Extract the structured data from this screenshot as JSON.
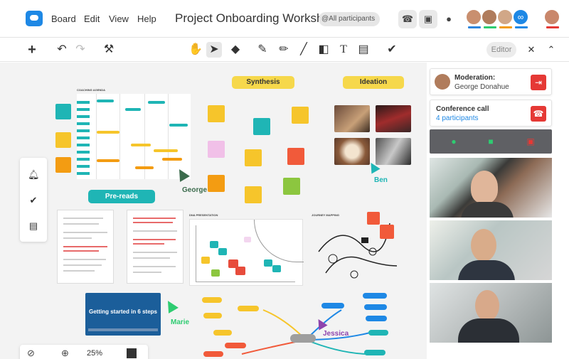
{
  "topbar": {
    "menu": [
      "Board",
      "Edit",
      "View",
      "Help"
    ],
    "title": "Project Onboarding Workshop",
    "participants_badge": "@All participants",
    "icons": [
      "phone-icon",
      "screen-share-icon",
      "chat-icon"
    ],
    "avatars": [
      {
        "name": "participant-1",
        "bar_color": "#2e86de"
      },
      {
        "name": "participant-2",
        "bar_color": "#2ecc71"
      },
      {
        "name": "participant-3",
        "bar_color": "#f39c12"
      },
      {
        "name": "link-participants",
        "bar_color": "#1e88e5"
      },
      {
        "name": "current-user",
        "bar_color": "#e53935"
      }
    ]
  },
  "toolbar": {
    "editor_label": "Editor"
  },
  "canvas": {
    "headings": {
      "synthesis": "Synthesis",
      "ideation": "Ideation",
      "pre_reads": "Pre-reads"
    },
    "small_titles": {
      "coaching_agenda": "COACHING AGENDA",
      "dna": "DNA PRESENTATION",
      "journey": "JOURNEY MAPPING"
    },
    "cursors": {
      "george": "George",
      "ben": "Ben",
      "marie": "Marie",
      "jessica": "Jessica"
    },
    "video_card": {
      "title": "Getting started in 6 steps"
    },
    "zoom": "25%"
  },
  "right_panel": {
    "moderation": {
      "title": "Moderation:",
      "name": "George Donahue"
    },
    "conference": {
      "title": "Conference call",
      "participants": "4 participants"
    }
  },
  "colors": {
    "accent_teal": "#1fb5b5",
    "sticky_yellow": "#f6c52b",
    "sticky_orange": "#f39c12",
    "sticky_red": "#e74c3c",
    "danger": "#e53935",
    "brand_blue": "#1e88e5"
  }
}
